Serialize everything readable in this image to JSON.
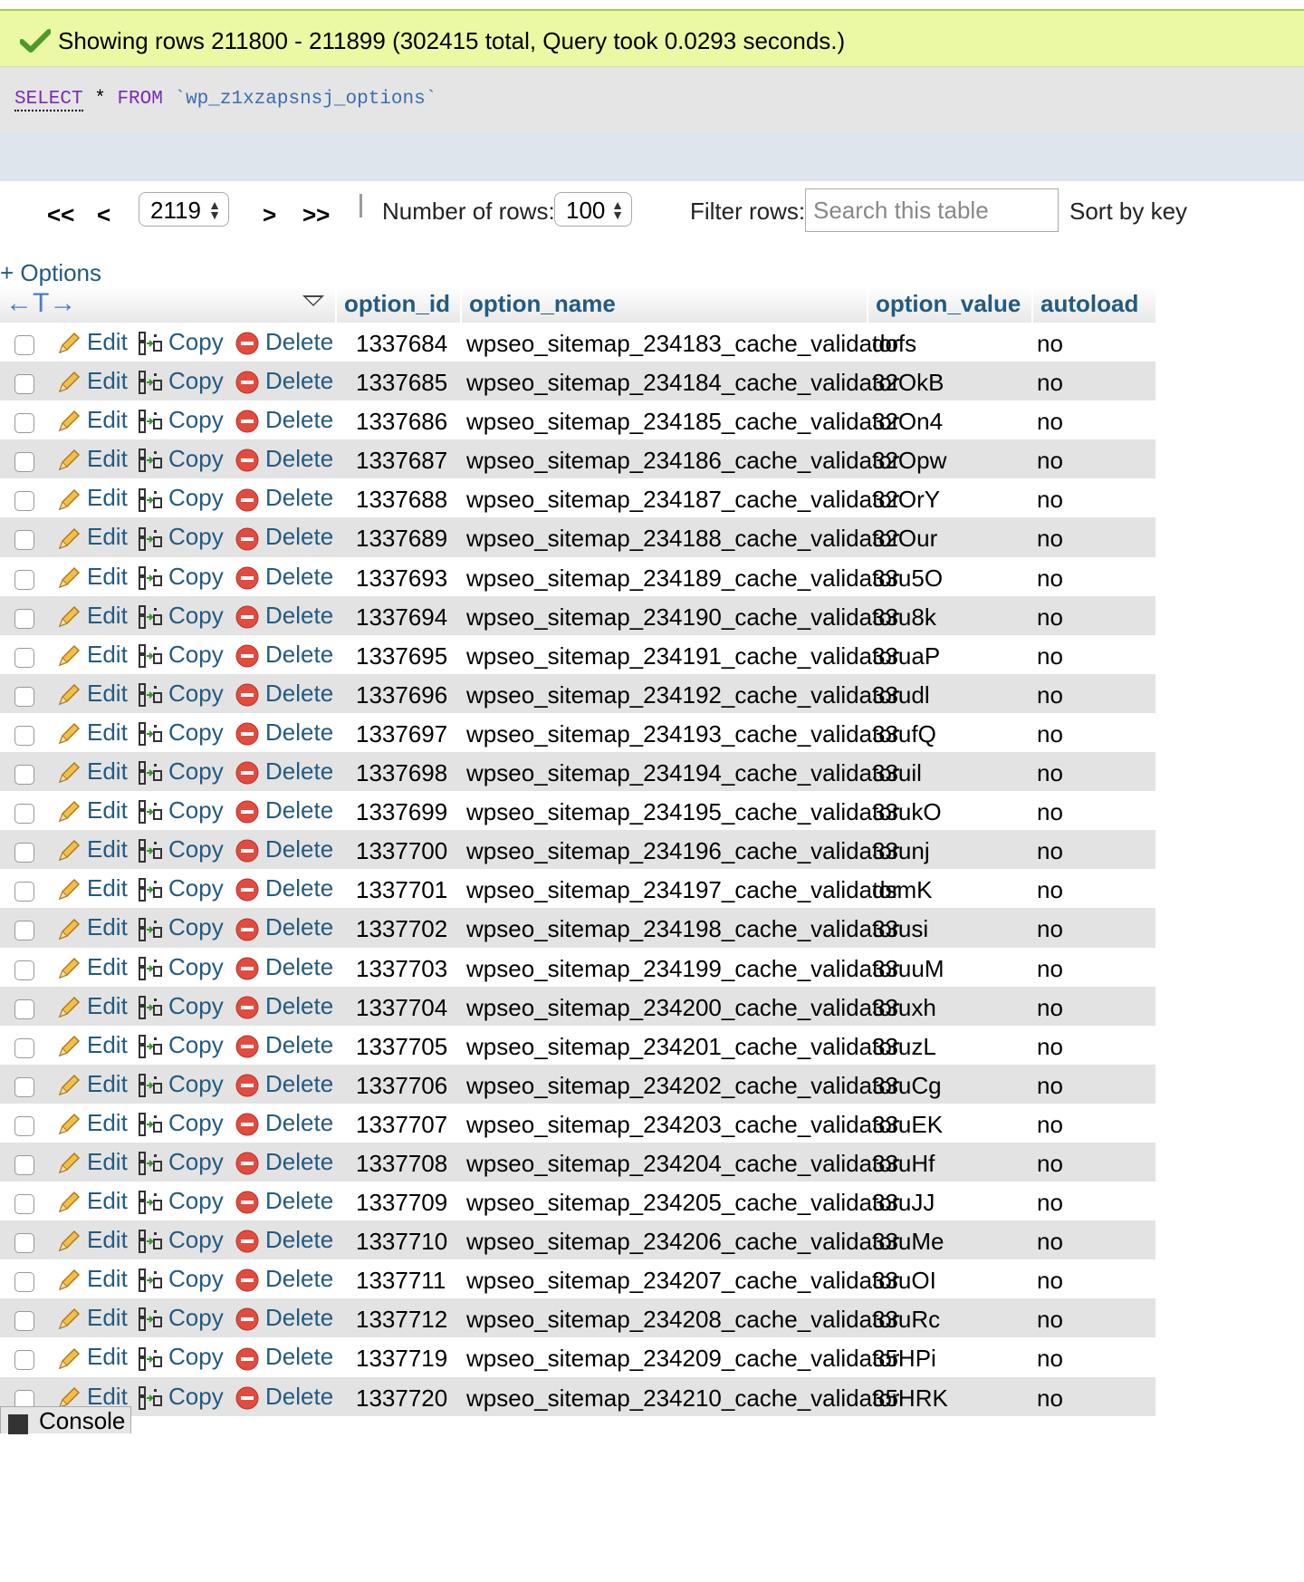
{
  "status": {
    "message": "Showing rows 211800 - 211899 (302415 total, Query took 0.0293 seconds.)"
  },
  "sql": {
    "select": "SELECT",
    "star": " * ",
    "from": "FROM",
    "table": " `wp_z1xzapsnsj_options`"
  },
  "nav": {
    "first": "<<",
    "prev": "<",
    "page": "2119",
    "next": ">",
    "last": ">>",
    "rows_label": "Number of rows:",
    "rows_value": "100",
    "filter_label": "Filter rows:",
    "filter_placeholder": "Search this table",
    "sort_label": "Sort by key"
  },
  "options_link": "+ Options",
  "table": {
    "columns": [
      "option_id",
      "option_name",
      "option_value",
      "autoload"
    ],
    "actions": {
      "edit": "Edit",
      "copy": "Copy",
      "delete": "Delete"
    },
    "rows": [
      [
        "1337684",
        "wpseo_sitemap_234183_cache_validator",
        "dofs",
        "no"
      ],
      [
        "1337685",
        "wpseo_sitemap_234184_cache_validator",
        "32OkB",
        "no"
      ],
      [
        "1337686",
        "wpseo_sitemap_234185_cache_validator",
        "32On4",
        "no"
      ],
      [
        "1337687",
        "wpseo_sitemap_234186_cache_validator",
        "32Opw",
        "no"
      ],
      [
        "1337688",
        "wpseo_sitemap_234187_cache_validator",
        "32OrY",
        "no"
      ],
      [
        "1337689",
        "wpseo_sitemap_234188_cache_validator",
        "32Our",
        "no"
      ],
      [
        "1337693",
        "wpseo_sitemap_234189_cache_validator",
        "33u5O",
        "no"
      ],
      [
        "1337694",
        "wpseo_sitemap_234190_cache_validator",
        "33u8k",
        "no"
      ],
      [
        "1337695",
        "wpseo_sitemap_234191_cache_validator",
        "33uaP",
        "no"
      ],
      [
        "1337696",
        "wpseo_sitemap_234192_cache_validator",
        "33udl",
        "no"
      ],
      [
        "1337697",
        "wpseo_sitemap_234193_cache_validator",
        "33ufQ",
        "no"
      ],
      [
        "1337698",
        "wpseo_sitemap_234194_cache_validator",
        "33uil",
        "no"
      ],
      [
        "1337699",
        "wpseo_sitemap_234195_cache_validator",
        "33ukO",
        "no"
      ],
      [
        "1337700",
        "wpseo_sitemap_234196_cache_validator",
        "33unj",
        "no"
      ],
      [
        "1337701",
        "wpseo_sitemap_234197_cache_validator",
        "dsmK",
        "no"
      ],
      [
        "1337702",
        "wpseo_sitemap_234198_cache_validator",
        "33usi",
        "no"
      ],
      [
        "1337703",
        "wpseo_sitemap_234199_cache_validator",
        "33uuM",
        "no"
      ],
      [
        "1337704",
        "wpseo_sitemap_234200_cache_validator",
        "33uxh",
        "no"
      ],
      [
        "1337705",
        "wpseo_sitemap_234201_cache_validator",
        "33uzL",
        "no"
      ],
      [
        "1337706",
        "wpseo_sitemap_234202_cache_validator",
        "33uCg",
        "no"
      ],
      [
        "1337707",
        "wpseo_sitemap_234203_cache_validator",
        "33uEK",
        "no"
      ],
      [
        "1337708",
        "wpseo_sitemap_234204_cache_validator",
        "33uHf",
        "no"
      ],
      [
        "1337709",
        "wpseo_sitemap_234205_cache_validator",
        "33uJJ",
        "no"
      ],
      [
        "1337710",
        "wpseo_sitemap_234206_cache_validator",
        "33uMe",
        "no"
      ],
      [
        "1337711",
        "wpseo_sitemap_234207_cache_validator",
        "33uOI",
        "no"
      ],
      [
        "1337712",
        "wpseo_sitemap_234208_cache_validator",
        "33uRc",
        "no"
      ],
      [
        "1337719",
        "wpseo_sitemap_234209_cache_validator",
        "35HPi",
        "no"
      ],
      [
        "1337720",
        "wpseo_sitemap_234210_cache_validator",
        "35HRK",
        "no"
      ]
    ]
  },
  "console": {
    "label": "Console"
  },
  "colors": {
    "success_bg": "#ebf8a4",
    "link": "#235a81",
    "delete_red": "#e34b3f",
    "row_alt": "#e3e3e3"
  }
}
